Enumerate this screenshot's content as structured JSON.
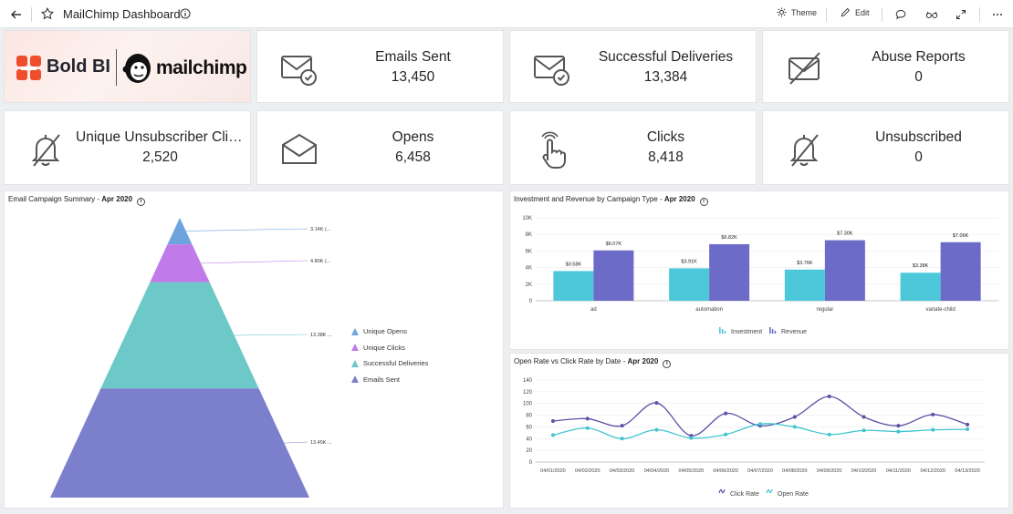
{
  "toolbar": {
    "title": "MailChimp Dashboard",
    "theme_label": "Theme",
    "edit_label": "Edit"
  },
  "logos": {
    "boldbi": "Bold BI",
    "mailchimp": "mailchimp"
  },
  "kpis": [
    {
      "label": "Emails Sent",
      "value": "13,450",
      "icon": "envelope-check-icon"
    },
    {
      "label": "Successful Deliveries",
      "value": "13,384",
      "icon": "envelope-check-icon"
    },
    {
      "label": "Abuse Reports",
      "value": "0",
      "icon": "envelope-slash-icon"
    },
    {
      "label": "Unique Unsubscriber Clic...",
      "value": "2,520",
      "icon": "bell-slash-icon"
    },
    {
      "label": "Opens",
      "value": "6,458",
      "icon": "envelope-icon"
    },
    {
      "label": "Clicks",
      "value": "8,418",
      "icon": "pointer-hand-icon"
    },
    {
      "label": "Unsubscribed",
      "value": "0",
      "icon": "bell-slash-icon"
    }
  ],
  "pyramid": {
    "title_prefix": "Email Campaign Summary - ",
    "title_date": "Apr 2020"
  },
  "bar": {
    "title_prefix": "Investment and Revenue by Campaign Type - ",
    "title_date": "Apr 2020"
  },
  "line": {
    "title_prefix": "Open Rate vs Click Rate by Date - ",
    "title_date": "Apr 2020"
  },
  "chart_data": [
    {
      "type": "pyramid",
      "segments": [
        {
          "name": "Unique Opens",
          "label": "3.14K (...",
          "color": "#6ea4de"
        },
        {
          "name": "Unique Clicks",
          "label": "4.80K (...",
          "color": "#c07be8"
        },
        {
          "name": "Successful Deliveries",
          "label": "13.38K ...",
          "color": "#6cc9c7"
        },
        {
          "name": "Emails Sent",
          "label": "13.45K ...",
          "color": "#7c7fcb"
        }
      ]
    },
    {
      "type": "bar",
      "categories": [
        "ad",
        "automation",
        "regular",
        "variate-child"
      ],
      "series": [
        {
          "name": "Investment",
          "values": [
            3580,
            3910,
            3760,
            3380
          ],
          "labels": [
            "$3.58K",
            "$3.91K",
            "$3.76K",
            "$3.38K"
          ],
          "color": "#4cc8da"
        },
        {
          "name": "Revenue",
          "values": [
            6070,
            6820,
            7300,
            7060
          ],
          "labels": [
            "$6.07K",
            "$6.82K",
            "$7.30K",
            "$7.06K"
          ],
          "color": "#6c6bc7"
        }
      ],
      "yticks": [
        "0",
        "2K",
        "4K",
        "6K",
        "8K",
        "10K"
      ],
      "ylim": [
        0,
        10000
      ]
    },
    {
      "type": "line",
      "x": [
        "04/01/2020",
        "04/02/2020",
        "04/03/2020",
        "04/04/2020",
        "04/05/2020",
        "04/06/2020",
        "04/07/2020",
        "04/08/2020",
        "04/09/2020",
        "04/10/2020",
        "04/11/2020",
        "04/12/2020",
        "04/13/2020"
      ],
      "series": [
        {
          "name": "Click Rate",
          "values": [
            70,
            74,
            62,
            101,
            45,
            83,
            62,
            77,
            112,
            77,
            62,
            81,
            64
          ],
          "color": "#5b4fa6"
        },
        {
          "name": "Open Rate",
          "values": [
            46,
            58,
            40,
            55,
            41,
            47,
            65,
            60,
            47,
            54,
            52,
            55,
            56
          ],
          "color": "#3fc4d0"
        }
      ],
      "yticks": [
        "0",
        "20",
        "40",
        "60",
        "80",
        "100",
        "120",
        "140"
      ],
      "ylim": [
        0,
        140
      ]
    }
  ]
}
